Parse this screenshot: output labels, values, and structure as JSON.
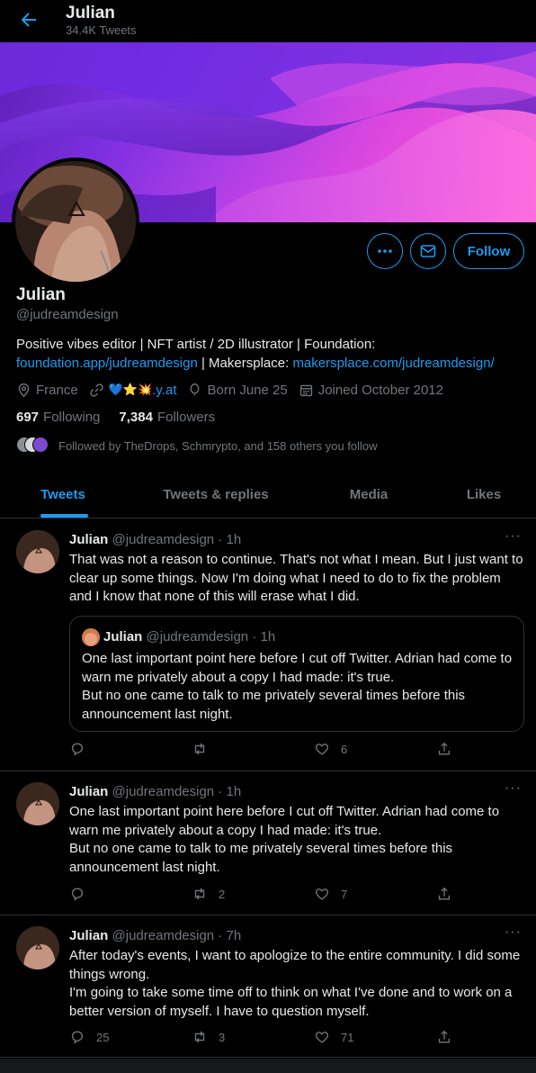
{
  "header": {
    "title": "Julian",
    "subtitle": "34.4K Tweets"
  },
  "profile": {
    "name": "Julian",
    "handle": "@judreamdesign",
    "bio_text": "Positive vibes editor | NFT artist / 2D illustrator | Foundation:",
    "bio_link1": "foundation.app/judreamdesign",
    "bio_sep": " | Makersplace: ",
    "bio_link2": "makersplace.com/judreamdesign/",
    "location": "France",
    "website_emoji": "💙⭐💥",
    "website_suffix": ".y.at",
    "born": "Born June 25",
    "joined": "Joined October 2012",
    "following_count": "697",
    "following_label": "Following",
    "followers_count": "7,384",
    "followers_label": "Followers",
    "followed_by": "Followed by TheDrops, Schmrypto, and 158 others you follow",
    "follow_label": "Follow"
  },
  "tabs": [
    {
      "label": "Tweets",
      "active": true
    },
    {
      "label": "Tweets & replies",
      "active": false
    },
    {
      "label": "Media",
      "active": false
    },
    {
      "label": "Likes",
      "active": false
    }
  ],
  "tweets": [
    {
      "name": "Julian",
      "handle": "@judreamdesign",
      "time": "· 1h",
      "text": "That was not a reason to continue. That's not what I mean. But I just want to clear up some things. Now I'm doing what I need to do to fix the problem and I know that none of this will erase what I did.",
      "quote": {
        "name": "Julian",
        "handle": "@judreamdesign",
        "time": "· 1h",
        "text": "One last important point here before I cut off Twitter. Adrian had come to warn me privately about a copy I had made: it's true.\nBut no one came to talk to me privately several times before this announcement last night."
      },
      "replies": "",
      "retweets": "",
      "likes": "6"
    },
    {
      "name": "Julian",
      "handle": "@judreamdesign",
      "time": "· 1h",
      "text": "One last important point here before I cut off Twitter. Adrian had come to warn me privately about a copy I had made: it's true.\nBut no one came to talk to me privately several times before this announcement last night.",
      "replies": "",
      "retweets": "2",
      "likes": "7"
    },
    {
      "name": "Julian",
      "handle": "@judreamdesign",
      "time": "· 7h",
      "text": "After today's events, I want to apologize to the entire community. I did some things wrong.\nI'm going to take some time off to think on what I've done and to work on a better version of myself. I have to question myself.",
      "replies": "25",
      "retweets": "3",
      "likes": "71"
    }
  ],
  "colors": {
    "accent": "#1d9bf0",
    "background": "#000000",
    "muted": "#71767b",
    "border": "#2f3336"
  }
}
